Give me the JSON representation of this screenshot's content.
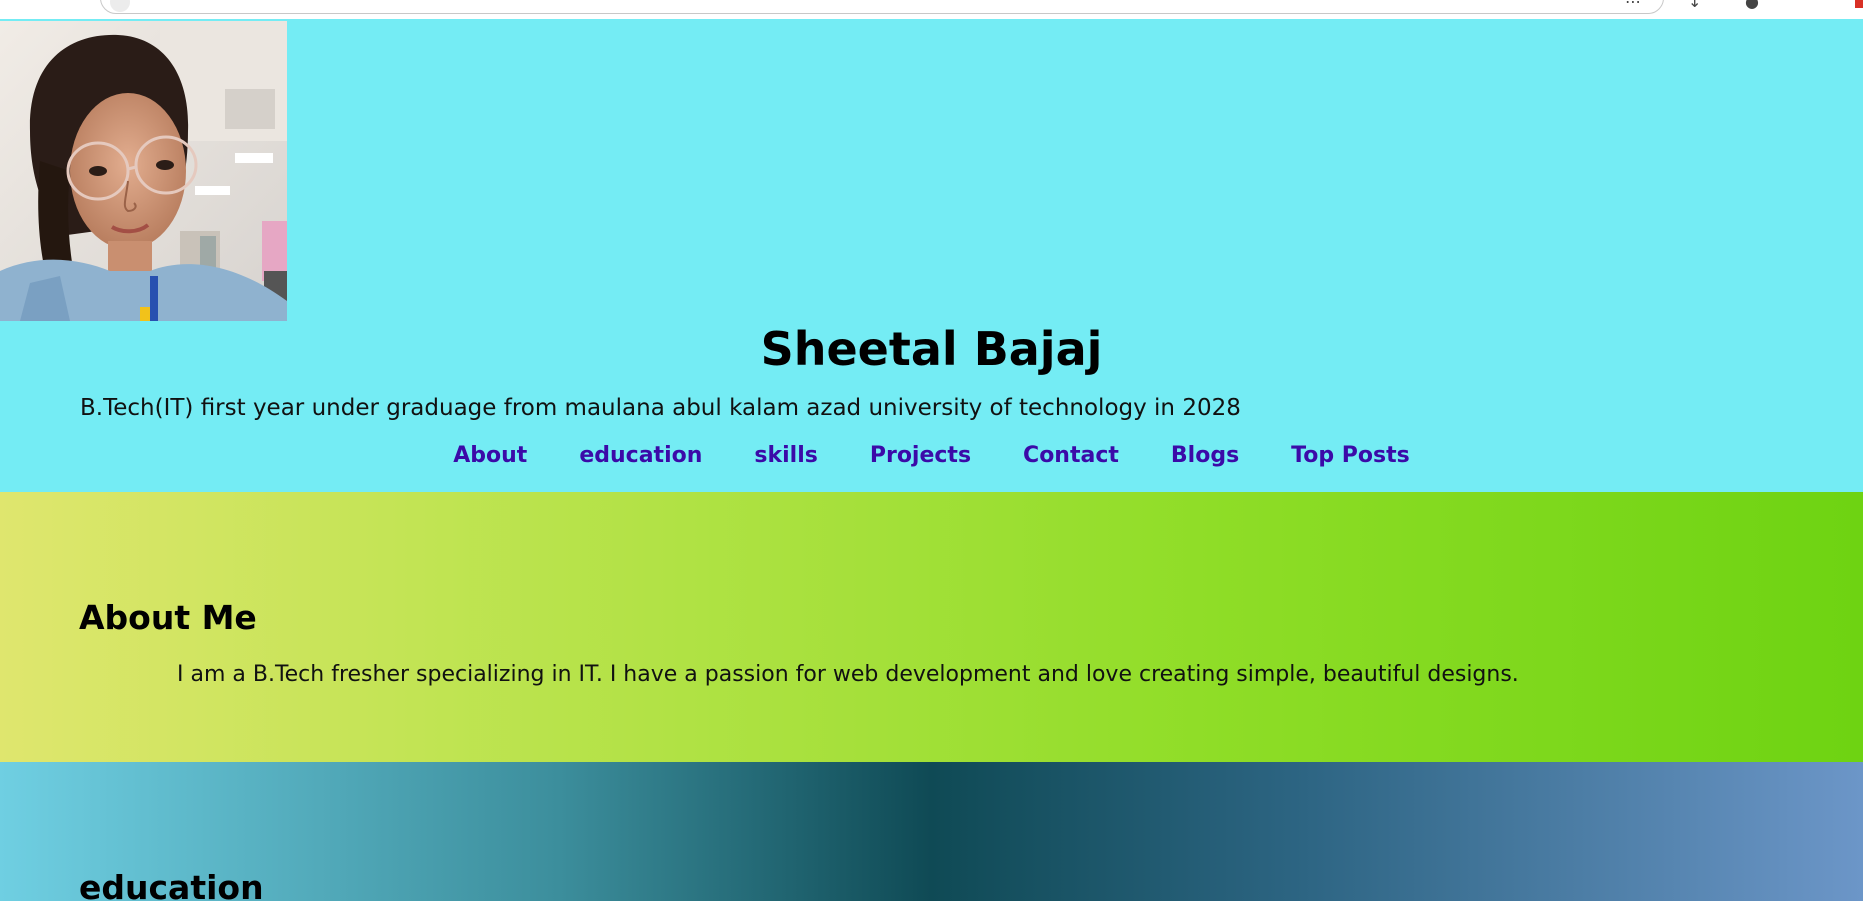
{
  "header": {
    "name": "Sheetal Bajaj",
    "tagline": "B.Tech(IT) first year under graduage from maulana abul kalam azad university of technology in 2028",
    "background_color": "#74ecf4"
  },
  "nav": {
    "items": [
      {
        "label": "About"
      },
      {
        "label": "education"
      },
      {
        "label": "skills"
      },
      {
        "label": "Projects"
      },
      {
        "label": "Contact"
      },
      {
        "label": "Blogs"
      },
      {
        "label": "Top Posts"
      }
    ],
    "link_color": "#3b0aa8"
  },
  "about": {
    "heading": "About Me",
    "text": "I am a B.Tech fresher specializing in IT. I have a passion for web development and love creating simple, beautiful designs.",
    "gradient_colors": [
      "#dfe66e",
      "#6ed312"
    ]
  },
  "education": {
    "heading": "education",
    "gradient_colors": [
      "#6fcfe2",
      "#0f4a55",
      "#6c96c8"
    ]
  },
  "icons": {
    "profile": "profile-photo"
  }
}
